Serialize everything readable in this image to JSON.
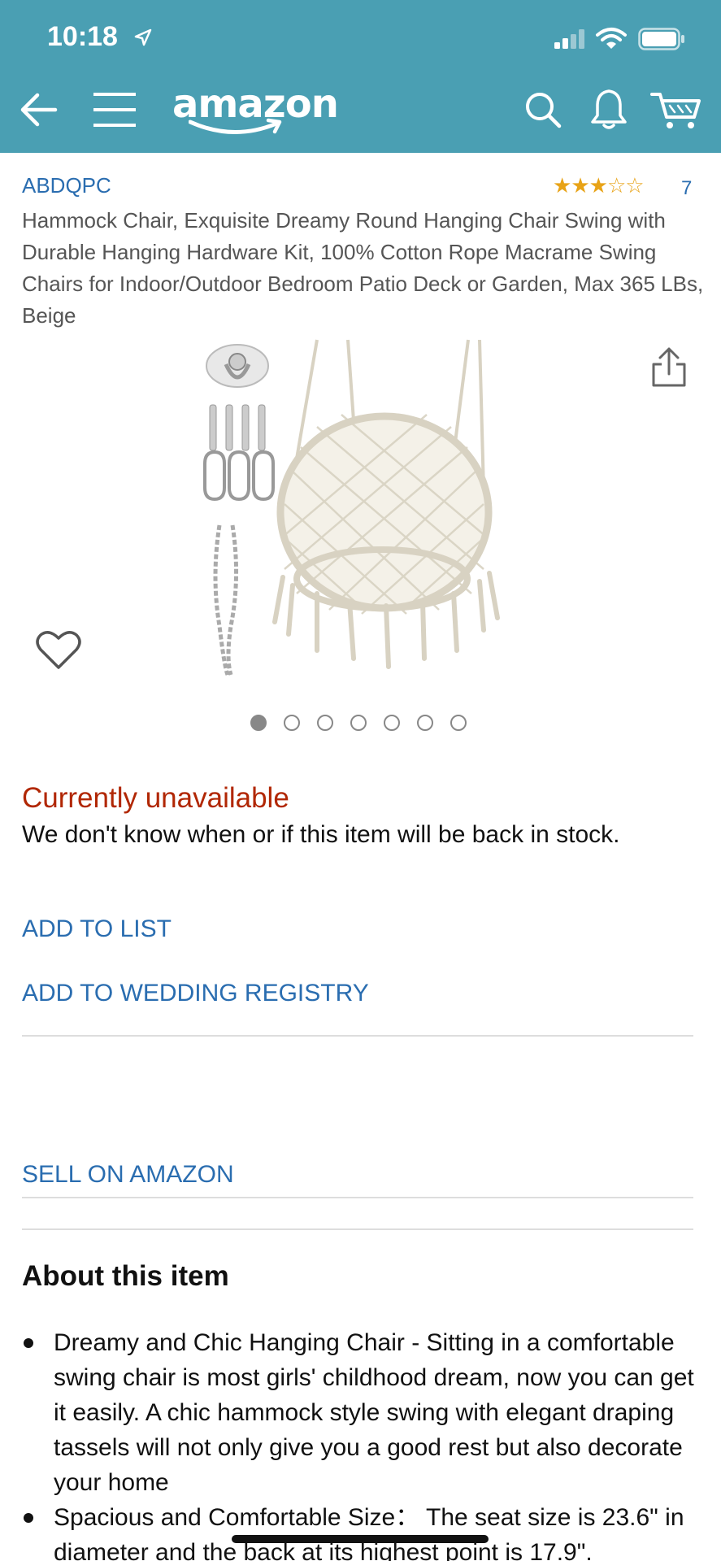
{
  "status_bar": {
    "time": "10:18"
  },
  "header": {
    "logo": "amazon",
    "background_color": "#4a9fb3"
  },
  "product": {
    "brand": "ABDQPC",
    "rating_stars": 3,
    "rating_max": 5,
    "rating_count": "7",
    "title": "Hammock Chair, Exquisite Dreamy Round Hanging Chair Swing with Durable Hanging Hardware Kit, 100% Cotton Rope Macrame Swing Chairs for Indoor/Outdoor Bedroom Patio Deck or Garden, Max 365 LBs, Beige",
    "image_count": 7,
    "active_image_index": 0
  },
  "availability": {
    "status": "Currently unavailable",
    "message": "We don't know when or if this item will be back in stock."
  },
  "actions": {
    "add_to_list": "ADD TO LIST",
    "add_to_wedding_registry": "ADD TO WEDDING REGISTRY",
    "sell_on_amazon": "SELL ON AMAZON"
  },
  "about": {
    "heading": "About this item",
    "bullets": [
      "Dreamy and Chic Hanging Chair - Sitting in a comfortable swing chair is most girls' childhood dream, now you can get it easily. A chic hammock style swing with elegant draping tassels will not only give you a good rest but also decorate your home",
      "Spacious and Comfortable Size： The seat size is 23.6\" in diameter and the back at its highest point is 17.9\"."
    ]
  },
  "colors": {
    "link": "#2a6db0",
    "unavailable": "#b12704",
    "star": "#e8a317"
  }
}
